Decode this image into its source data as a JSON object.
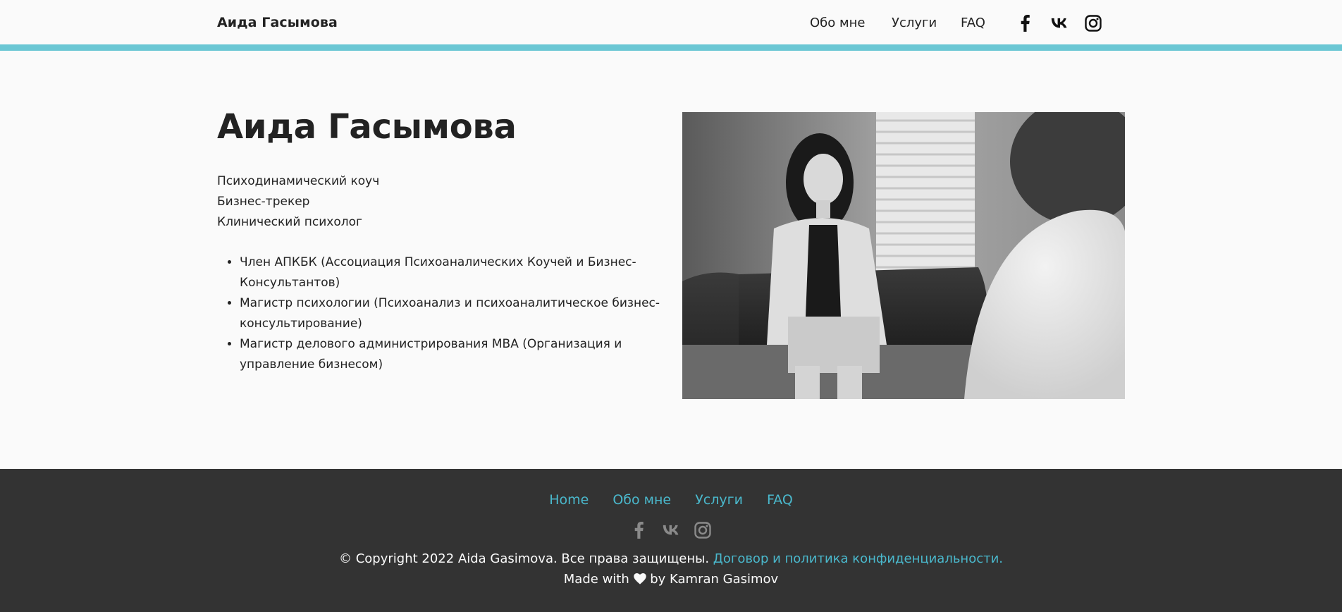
{
  "header": {
    "brand": "Аида Гасымова",
    "nav": [
      {
        "label": "Обо мне"
      },
      {
        "label": "Услуги"
      },
      {
        "label": "FAQ"
      }
    ],
    "social_icons": [
      "facebook-icon",
      "vk-icon",
      "instagram-icon"
    ]
  },
  "colors": {
    "accent": "#6bc7d4",
    "link": "#4ab8cc",
    "footer_bg": "#333333",
    "page_bg": "#fafafa"
  },
  "hero": {
    "title": "Аида Гасымова",
    "roles": [
      "Психодинамический коуч",
      "Бизнес-трекер",
      "Клинический психолог"
    ],
    "credentials": [
      "Член АПКБК (Ассоциация Психоаналических Коучей и Бизнес-Консультантов)",
      "Магистр психологии (Психоанализ и психоаналитическое бизнес-консультирование)",
      "Магистр делового администрирования MBA (Организация и управление бизнесом)"
    ],
    "photo_icon": "portrait-photo"
  },
  "footer": {
    "nav": [
      {
        "label": "Home"
      },
      {
        "label": "Обо мне"
      },
      {
        "label": "Услуги"
      },
      {
        "label": "FAQ"
      }
    ],
    "social_icons": [
      "facebook-icon",
      "vk-icon",
      "instagram-icon"
    ],
    "copyright": "© Copyright 2022 Aida Gasimova. Все права защищены.",
    "policy_link": "Договор и политика конфиденциальности.",
    "made_with_prefix": "Made with",
    "made_with_suffix": "by Kamran Gasimov",
    "heart_icon": "heart-icon"
  }
}
